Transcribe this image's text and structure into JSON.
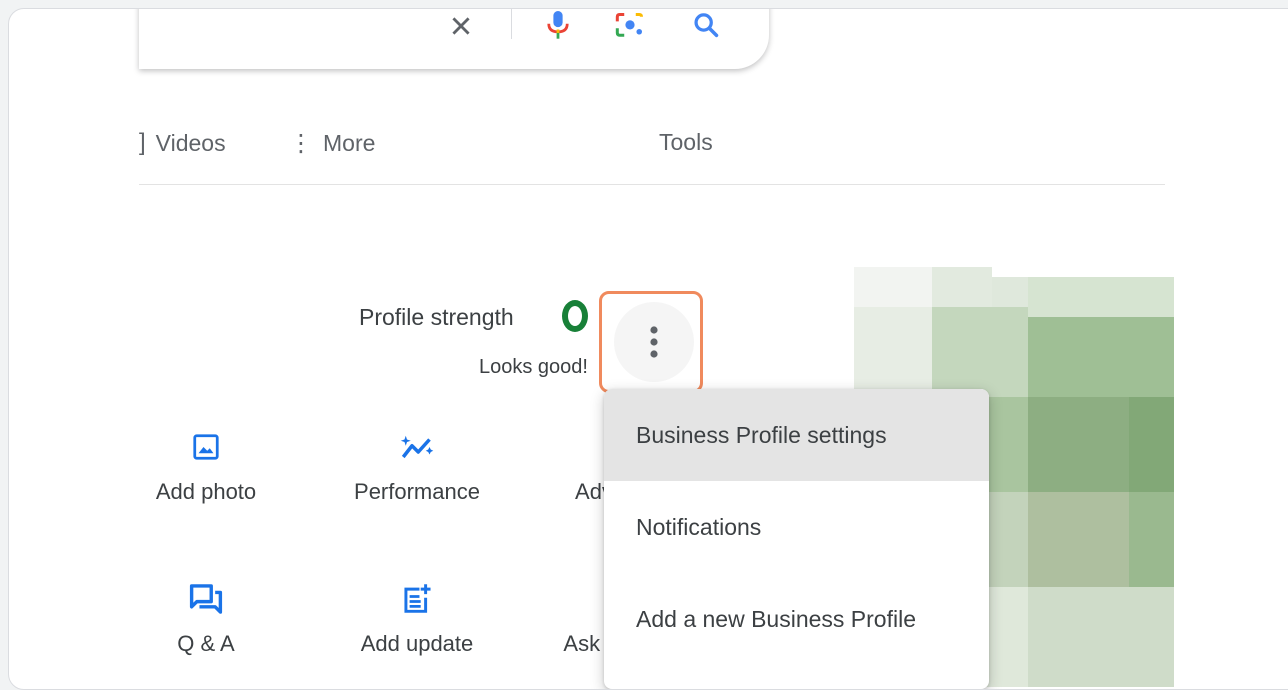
{
  "search": {
    "icons": [
      "close-icon",
      "microphone-icon",
      "lens-icon",
      "search-icon"
    ]
  },
  "tabs": [
    {
      "label": "Videos",
      "icon": "video-icon"
    },
    {
      "label": "More",
      "icon": "more-vertical-icon"
    },
    {
      "label": "Tools"
    }
  ],
  "profile": {
    "strength_label": "Profile strength",
    "status": "Looks good!"
  },
  "actions": [
    {
      "label": "Add photo",
      "icon": "image-icon"
    },
    {
      "label": "Performance",
      "icon": "trending-sparkle-icon"
    },
    {
      "label": "Adv",
      "icon": "advertise-icon"
    },
    {
      "label": "Q & A",
      "icon": "forum-icon"
    },
    {
      "label": "Add update",
      "icon": "post-add-icon"
    },
    {
      "label": "Ask fo",
      "icon": "review-icon"
    }
  ],
  "menu": {
    "items": [
      "Business Profile settings",
      "Notifications",
      "Add a new Business Profile"
    ],
    "highlighted_index": 0
  },
  "colors": {
    "google_blue": "#1a73e8",
    "ring_green": "#188038",
    "highlight_border": "#f08a5d"
  }
}
